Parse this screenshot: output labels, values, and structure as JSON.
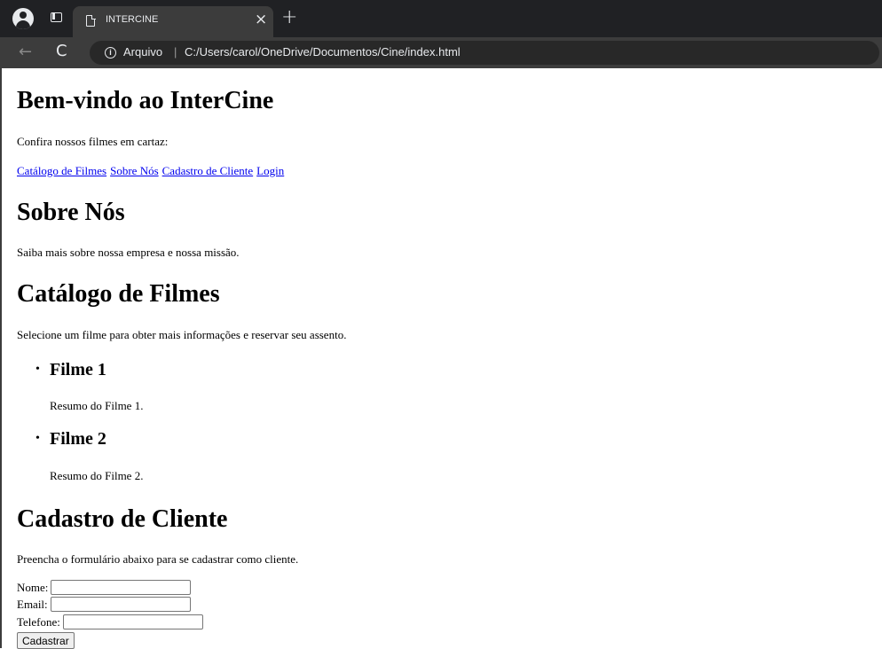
{
  "browser": {
    "tab_title": "INTERCINE",
    "close_glyph": "×",
    "newtab_glyph": "+",
    "back_glyph": "←",
    "reload_glyph": "C",
    "info_glyph": "i",
    "scheme_label": "Arquivo",
    "separator": "|",
    "url": "C:/Users/carol/OneDrive/Documentos/Cine/index.html"
  },
  "page": {
    "title": "Bem-vindo ao InterCine",
    "intro": "Confira nossos filmes em cartaz:",
    "nav": [
      "Catálogo de Filmes",
      "Sobre Nós",
      "Cadastro de Cliente",
      "Login"
    ],
    "about": {
      "heading": "Sobre Nós",
      "text": "Saiba mais sobre nossa empresa e nossa missão."
    },
    "catalog": {
      "heading": "Catálogo de Filmes",
      "text": "Selecione um filme para obter mais informações e reservar seu assento.",
      "movies": [
        {
          "title": "Filme 1",
          "summary": "Resumo do Filme 1."
        },
        {
          "title": "Filme 2",
          "summary": "Resumo do Filme 2."
        }
      ]
    },
    "signup": {
      "heading": "Cadastro de Cliente",
      "text": "Preencha o formulário abaixo para se cadastrar como cliente.",
      "fields": [
        {
          "label": "Nome:",
          "value": ""
        },
        {
          "label": "Email:",
          "value": ""
        },
        {
          "label": "Telefone:",
          "value": ""
        }
      ],
      "submit_label": "Cadastrar"
    }
  },
  "colors": {
    "link": "#0000ee",
    "chrome_dark": "#202124",
    "chrome_toolbar": "#3c3c3c"
  }
}
